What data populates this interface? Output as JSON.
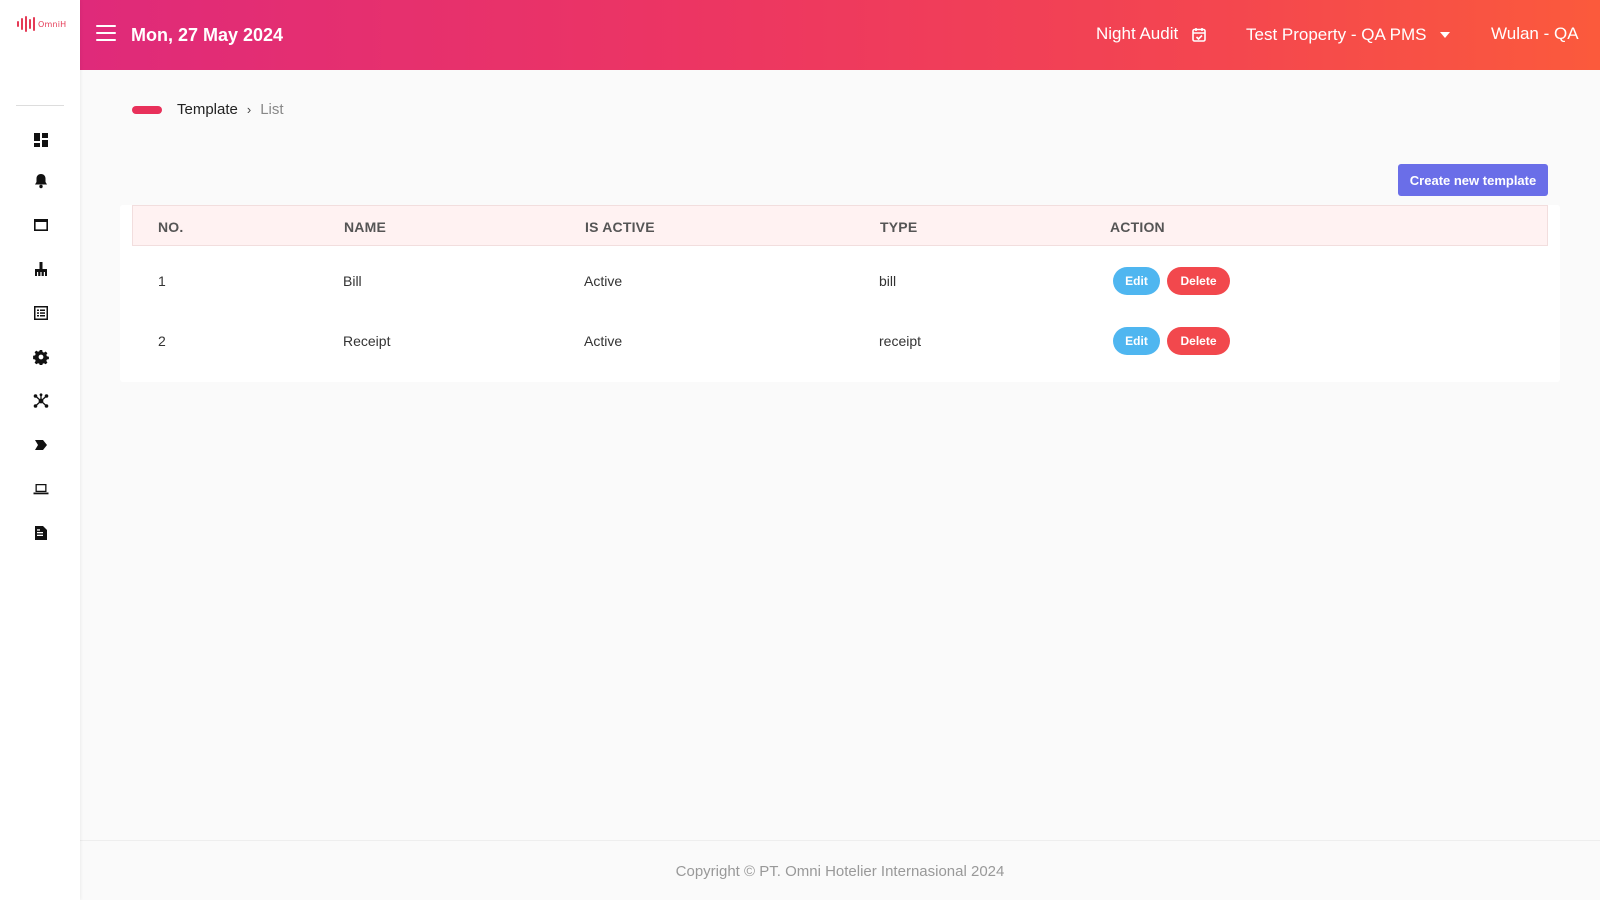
{
  "app": {
    "logo_text": "OmniH"
  },
  "sidebar": {
    "items": [
      {
        "icon": "dashboard-icon"
      },
      {
        "icon": "bell-icon"
      },
      {
        "icon": "window-icon"
      },
      {
        "icon": "cleaning-icon"
      },
      {
        "icon": "list-icon"
      },
      {
        "icon": "gear-icon"
      },
      {
        "icon": "network-icon"
      },
      {
        "icon": "arrow-tag-icon"
      },
      {
        "icon": "laptop-icon"
      },
      {
        "icon": "document-icon"
      }
    ]
  },
  "header": {
    "date": "Mon, 27 May 2024",
    "night_audit": "Night Audit",
    "property": "Test Property - QA PMS",
    "user": "Wulan - QA"
  },
  "breadcrumb": {
    "main": "Template",
    "separator": "›",
    "current": "List"
  },
  "toolbar": {
    "create_label": "Create new template"
  },
  "table": {
    "columns": [
      "NO.",
      "NAME",
      "IS ACTIVE",
      "TYPE",
      "ACTION"
    ],
    "rows": [
      {
        "no": "1",
        "name": "Bill",
        "is_active": "Active",
        "type": "bill"
      },
      {
        "no": "2",
        "name": "Receipt",
        "is_active": "Active",
        "type": "receipt"
      }
    ],
    "edit_label": "Edit",
    "delete_label": "Delete"
  },
  "footer": {
    "copyright": "Copyright © PT. Omni Hotelier Internasional 2024"
  },
  "colors": {
    "gradient_start": "#df2a7a",
    "gradient_end": "#fb5a3c",
    "primary_button": "#6a6ee8",
    "edit_button": "#4fb6f0",
    "delete_button": "#f2484d",
    "header_row_bg": "#fff2f2"
  }
}
